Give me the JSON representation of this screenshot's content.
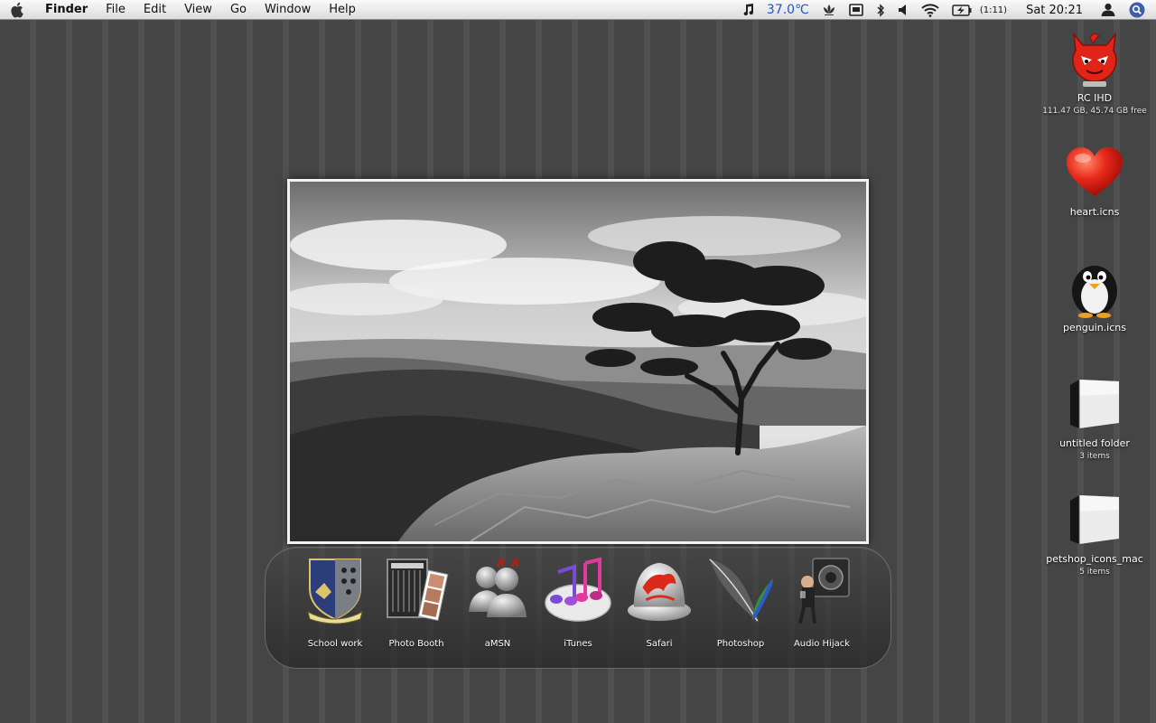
{
  "menubar": {
    "app_name": "Finder",
    "menus": [
      "File",
      "Edit",
      "View",
      "Go",
      "Window",
      "Help"
    ],
    "status": {
      "music_icon": "music-note-icon",
      "temperature": "37.0℃",
      "battery_time": "(1:11)",
      "clock": "Sat 20:21"
    }
  },
  "desktop_icons": [
    {
      "label": "RC IHD",
      "sub": "111.47 GB, 45.74 GB free",
      "icon": "hard-drive-devil-icon"
    },
    {
      "label": "heart.icns",
      "sub": "",
      "icon": "heart-icon"
    },
    {
      "label": "penguin.icns",
      "sub": "",
      "icon": "penguin-icon"
    },
    {
      "label": "untitled folder",
      "sub": "3 items",
      "icon": "folder-icon"
    },
    {
      "label": "petshop_icons_mac",
      "sub": "5 items",
      "icon": "folder-icon"
    }
  ],
  "dock": {
    "items": [
      {
        "label": "School work",
        "icon": "crest-icon"
      },
      {
        "label": "Photo Booth",
        "icon": "photo-booth-icon"
      },
      {
        "label": "aMSN",
        "icon": "amsn-icon"
      },
      {
        "label": "iTunes",
        "icon": "itunes-icon"
      },
      {
        "label": "Safari",
        "icon": "safari-icon"
      },
      {
        "label": "Photoshop",
        "icon": "feather-icon"
      },
      {
        "label": "Audio Hijack",
        "icon": "audio-hijack-icon"
      }
    ]
  },
  "colors": {
    "desktop": "#454545",
    "stripe": "#505050",
    "temperature": "#2256c8"
  }
}
